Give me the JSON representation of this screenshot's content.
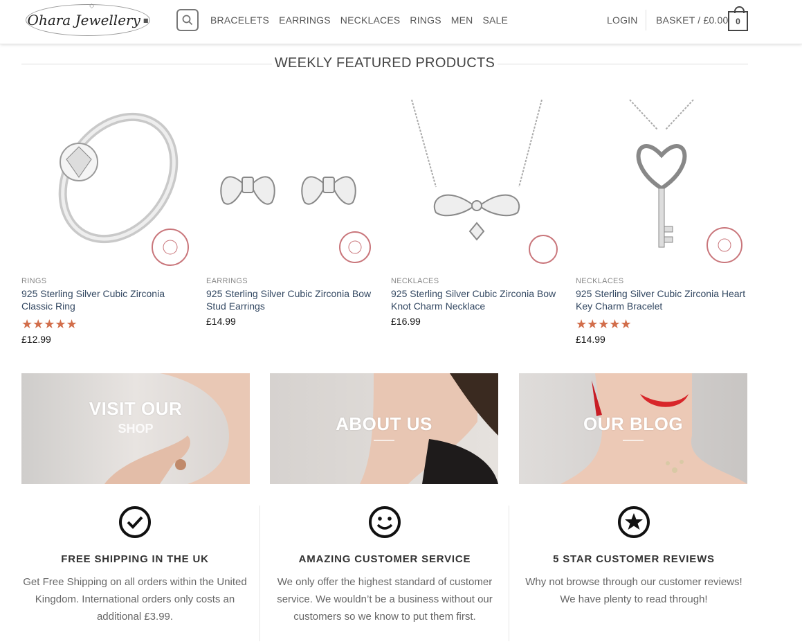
{
  "header": {
    "logo_text": "Ohara Jewellery",
    "nav": [
      "BRACELETS",
      "EARRINGS",
      "NECKLACES",
      "RINGS",
      "MEN",
      "SALE"
    ],
    "login": "LOGIN",
    "basket": "BASKET / £0.00",
    "basket_count": "0"
  },
  "featured": {
    "title": "WEEKLY FEATURED PRODUCTS",
    "products": [
      {
        "category": "RINGS",
        "name": "925 Sterling Silver Cubic Zirconia Classic Ring",
        "stars": "★★★★★",
        "price": "£12.99",
        "rated": true
      },
      {
        "category": "EARRINGS",
        "name": "925 Sterling Silver Cubic Zirconia Bow Stud Earrings",
        "stars": "",
        "price": "£14.99",
        "rated": false
      },
      {
        "category": "NECKLACES",
        "name": "925 Sterling Silver Cubic Zirconia Bow Knot Charm Necklace",
        "stars": "",
        "price": "£16.99",
        "rated": false
      },
      {
        "category": "NECKLACES",
        "name": "925 Sterling Silver Cubic Zirconia Heart Key Charm Bracelet",
        "stars": "★★★★★",
        "price": "£14.99",
        "rated": true
      }
    ]
  },
  "banners": [
    {
      "title": "VISIT OUR",
      "sub": "SHOP"
    },
    {
      "title": "ABOUT US"
    },
    {
      "title": "OUR BLOG"
    }
  ],
  "features": [
    {
      "icon": "check-circle-icon",
      "title": "FREE SHIPPING IN THE UK",
      "text": "Get Free Shipping on all orders within the United Kingdom. International orders only costs an additional £3.99."
    },
    {
      "icon": "smiley-icon",
      "title": "AMAZING CUSTOMER SERVICE",
      "text": "We only offer the highest standard of customer service. We wouldn’t be a business without our customers so we know to put them first."
    },
    {
      "icon": "star-circle-icon",
      "title": "5 STAR CUSTOMER REVIEWS",
      "text": "Why not browse through our customer reviews! We have plenty to read through!"
    }
  ],
  "colors": {
    "accent": "#d26e4b",
    "link": "#334862"
  }
}
